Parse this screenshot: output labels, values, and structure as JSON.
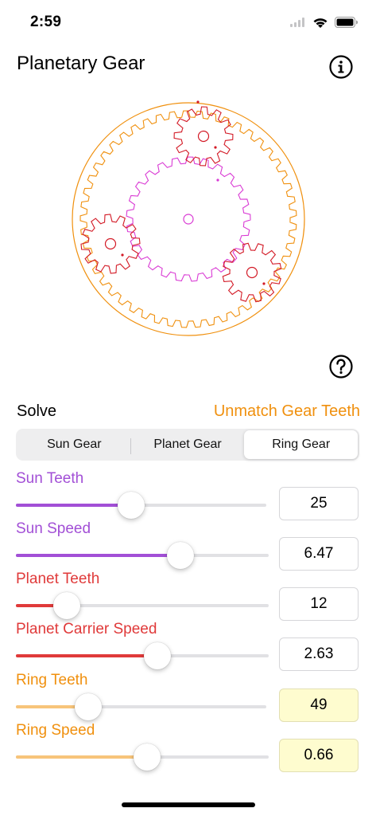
{
  "status_bar": {
    "time": "2:59"
  },
  "header": {
    "title": "Planetary Gear"
  },
  "icons": {
    "info": "info-circle-icon",
    "help": "question-circle-icon"
  },
  "colors": {
    "sun": "#a24fd6",
    "planet": "#e03a3a",
    "ring": "#f0900e",
    "ring_light": "#f7c47a",
    "sun_gear_stroke": "#d93ad4",
    "planet_gear_stroke": "#d31a26"
  },
  "gears": {
    "sun_teeth": 25,
    "planet_teeth": 12,
    "ring_teeth": 49,
    "planet_count": 3
  },
  "solve": {
    "label": "Solve",
    "unmatch_label": "Unmatch Gear Teeth"
  },
  "segmented": {
    "options": [
      "Sun Gear",
      "Planet Gear",
      "Ring Gear"
    ],
    "selected": "Ring Gear"
  },
  "controls": [
    {
      "label": "Sun Teeth",
      "value": "25",
      "level": 0.46,
      "color": "#a24fd6",
      "highlight": false
    },
    {
      "label": "Sun Speed",
      "value": "6.47",
      "level": 0.65,
      "color": "#a24fd6",
      "highlight": false
    },
    {
      "label": "Planet Teeth",
      "value": "12",
      "level": 0.2,
      "color": "#e03a3a",
      "highlight": false
    },
    {
      "label": "Planet Carrier Speed",
      "value": "2.63",
      "level": 0.56,
      "color": "#e03a3a",
      "highlight": false
    },
    {
      "label": "Ring Teeth",
      "value": "49",
      "level": 0.29,
      "color": "#f7c47a",
      "highlight": true
    },
    {
      "label": "Ring Speed",
      "value": "0.66",
      "level": 0.52,
      "color": "#f7c47a",
      "highlight": true
    }
  ]
}
